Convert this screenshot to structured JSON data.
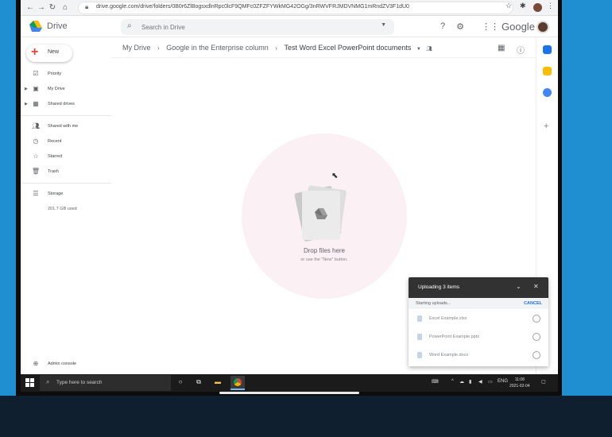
{
  "browser": {
    "url": "drive.google.com/drive/folders/0B0r6ZlBogsxdlnRpc0lcF9QMFc0ZFZFYWkMG42OGg/3nRWVFRJMDVNMG1mRndZV3F1dU0",
    "icons": [
      "back-icon",
      "forward-icon",
      "reload-icon",
      "home-icon",
      "star-icon",
      "extension-icon",
      "menu-icon"
    ]
  },
  "header": {
    "app_name": "Drive",
    "search_placeholder": "Search in Drive",
    "brand": "Google"
  },
  "sidebar": {
    "new_label": "New",
    "items": [
      {
        "label": "Priority",
        "icon": "checkbox-circle-icon"
      },
      {
        "label": "My Drive",
        "icon": "drive-folder-icon"
      },
      {
        "label": "Shared drives",
        "icon": "shared-drive-icon"
      },
      {
        "label": "Shared with me",
        "icon": "people-icon"
      },
      {
        "label": "Recent",
        "icon": "clock-icon"
      },
      {
        "label": "Starred",
        "icon": "star-outline-icon"
      },
      {
        "label": "Trash",
        "icon": "trash-icon"
      },
      {
        "label": "Storage",
        "icon": "storage-icon"
      }
    ],
    "storage_used": "201.7 GB used",
    "admin_console": "Admin console"
  },
  "breadcrumb": {
    "items": [
      "My Drive",
      "Google in the Enterprise column",
      "Test Word Excel PowerPoint documents"
    ]
  },
  "dropzone": {
    "title": "Drop files here",
    "subtitle": "or use the \"New\" button."
  },
  "upload_panel": {
    "title": "Uploading 3 items",
    "status": "Starting uploads...",
    "cancel": "CANCEL",
    "files": [
      "Excel Example.xlsx",
      "PowerPoint Example.pptx",
      "Word Example.docx"
    ]
  },
  "taskbar": {
    "search_placeholder": "Type here to search",
    "language": "ENG",
    "time": "11:08",
    "date": "2021-02-04"
  },
  "colors": {
    "accent_blue": "#1a73e8",
    "new_plus": "#ea4335",
    "desktop_bg": "#1f8fd1"
  }
}
